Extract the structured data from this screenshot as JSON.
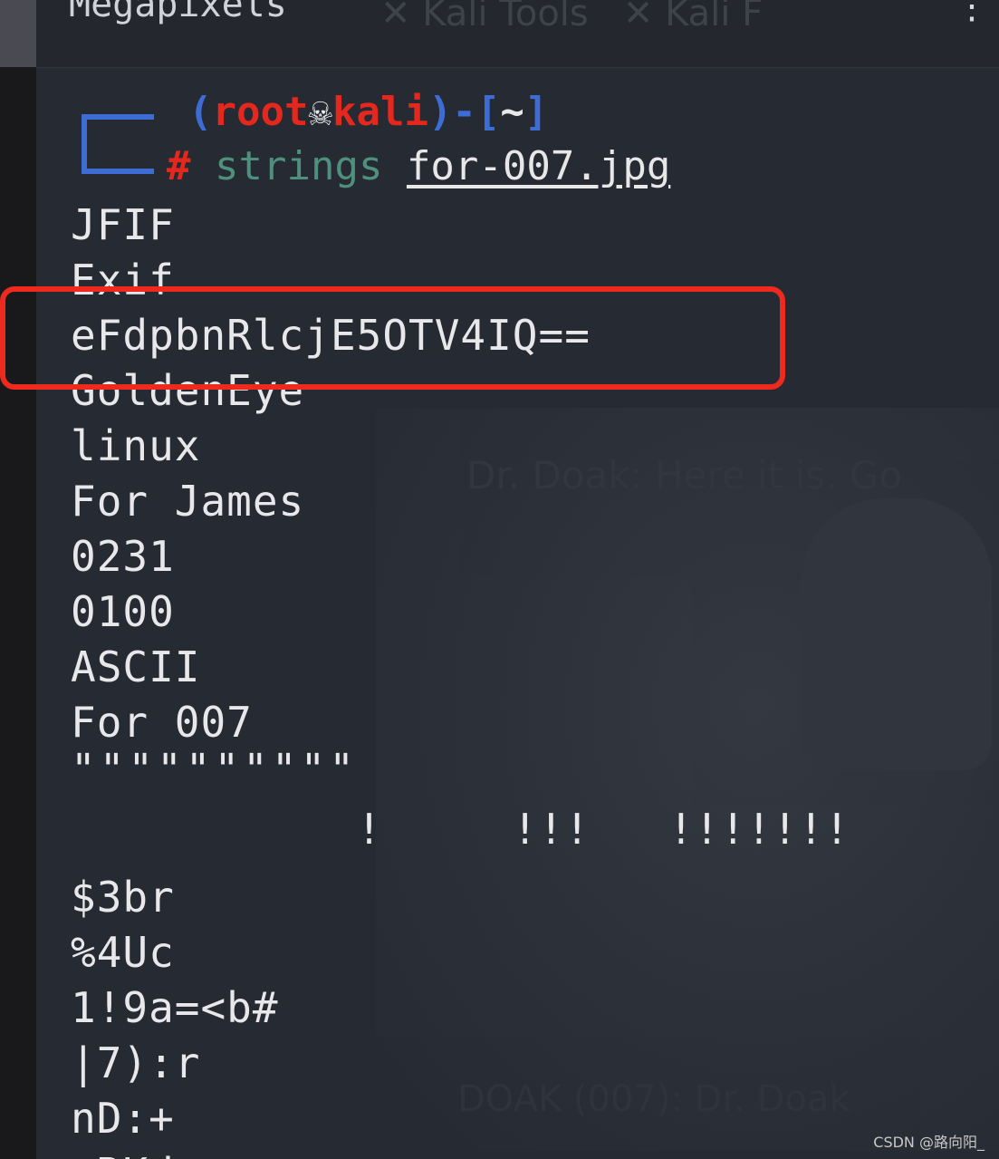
{
  "window": {
    "title": "Megapixels",
    "bookmarks": [
      "Kali Tools",
      "Kali F"
    ]
  },
  "prompt": {
    "open_paren": "(",
    "user": "root",
    "skull_icon": "skull-icon",
    "host": "kali",
    "close_part": ")-[",
    "cwd": "~",
    "close_bracket": "]",
    "symbol": "#",
    "command": "strings",
    "argument": "for-007.jpg"
  },
  "output_lines": [
    "JFIF",
    "Exif",
    "eFdpbnRlcjE5OTV4IQ==",
    "GoldenEye",
    "linux",
    "For James",
    "0231",
    "0100",
    "ASCII",
    "For 007",
    "\"\"\"\"\"\"\"\"\"\"",
    "           !     !!!   !!!!!!!",
    "$3br",
    "%4Uc",
    "1!9a=<b#",
    "|7):r",
    "nD:+",
    ":RKd"
  ],
  "wallpaper": {
    "caption": "Dr. Doak: Here it is. Go",
    "caption_bottom": "DOAK (007): Dr. Doak"
  },
  "watermark": "CSDN @路向阳_",
  "colors": {
    "prompt_bracket": "#3d6dd4",
    "prompt_user": "#e5281e",
    "command": "#4f8f7d",
    "highlight_box": "#ee2a1f",
    "terminal_bg": "#262a33"
  }
}
